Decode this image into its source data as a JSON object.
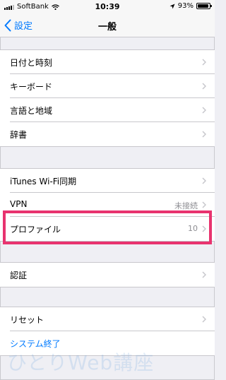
{
  "status_bar": {
    "carrier": "SoftBank",
    "time": "10:39",
    "battery": "93%"
  },
  "nav": {
    "back_label": "設定",
    "title": "一般"
  },
  "groups": [
    {
      "items": [
        {
          "label": "日付と時刻"
        },
        {
          "label": "キーボード"
        },
        {
          "label": "言語と地域"
        },
        {
          "label": "辞書"
        }
      ]
    },
    {
      "items": [
        {
          "label": "iTunes Wi-Fi同期"
        },
        {
          "label": "VPN",
          "value": "未接続"
        },
        {
          "label": "プロファイル",
          "value": "10"
        }
      ]
    },
    {
      "items": [
        {
          "label": "認証"
        }
      ]
    },
    {
      "items": [
        {
          "label": "リセット"
        },
        {
          "label": "システム終了"
        }
      ]
    }
  ],
  "watermark": "ひとりWeb講座",
  "colors": {
    "accent": "#007aff",
    "highlight": "#e8336f",
    "background": "#efeff4"
  }
}
